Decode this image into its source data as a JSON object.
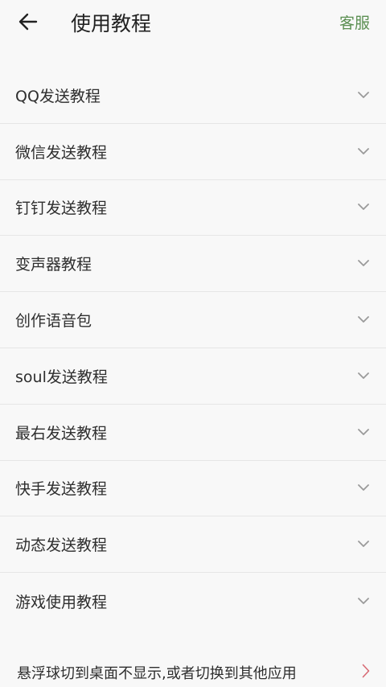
{
  "header": {
    "title": "使用教程",
    "right_action": "客服",
    "back_icon": "arrow-left-icon"
  },
  "tutorials": [
    {
      "label": "QQ发送教程"
    },
    {
      "label": "微信发送教程"
    },
    {
      "label": "钉钉发送教程"
    },
    {
      "label": "变声器教程"
    },
    {
      "label": "创作语音包"
    },
    {
      "label": "soul发送教程"
    },
    {
      "label": "最右发送教程"
    },
    {
      "label": "快手发送教程"
    },
    {
      "label": "动态发送教程"
    },
    {
      "label": "游戏使用教程"
    }
  ],
  "footer": {
    "label": "悬浮球切到桌面不显示,或者切换到其他应用",
    "icon": "chevron-right-icon"
  },
  "colors": {
    "accent": "#5b8f52",
    "chevron_right": "#d86a74",
    "chevron_down": "#9a9a9a",
    "background": "#f8f8f8"
  }
}
